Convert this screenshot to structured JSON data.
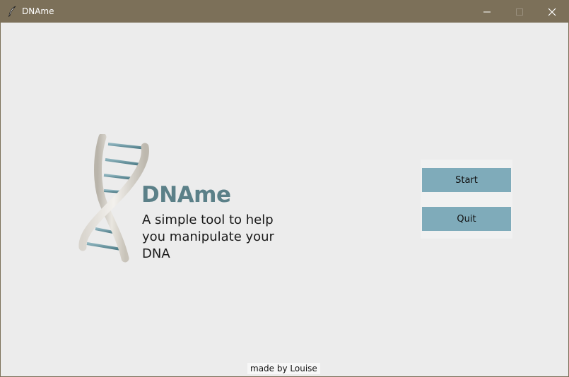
{
  "window": {
    "title": "DNAme",
    "icon": "feather-icon",
    "controls": [
      "minimize-icon",
      "maximize-icon",
      "close-icon"
    ]
  },
  "main": {
    "graphic": "dna-helix-icon",
    "app_name": "DNAme",
    "tagline": "A simple tool to help you manipulate your DNA",
    "buttons": {
      "start_label": "Start",
      "quit_label": "Quit"
    },
    "credit": "made by Louise"
  },
  "colors": {
    "titlebar": "#7c7059",
    "background": "#ececec",
    "accent": "#5b8088",
    "button": "#7fabba"
  }
}
